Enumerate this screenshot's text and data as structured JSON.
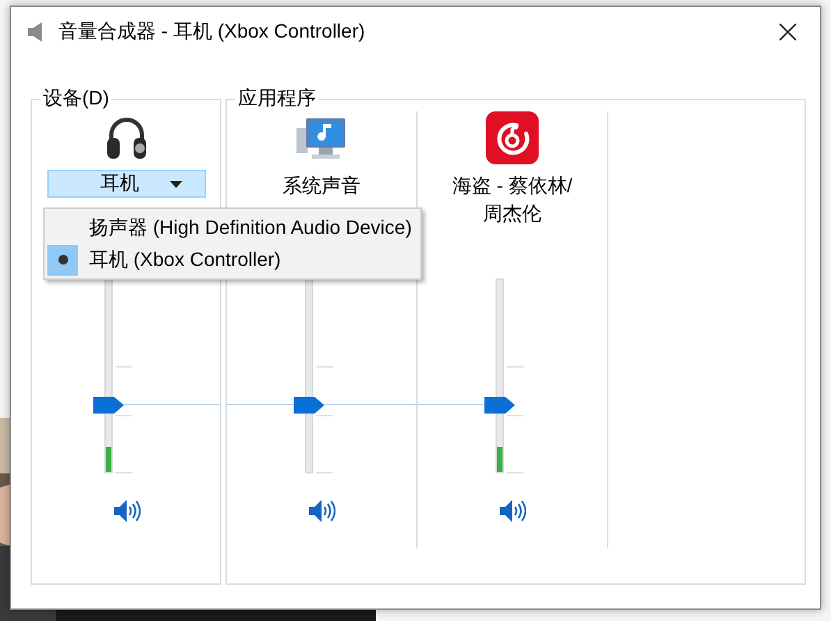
{
  "window": {
    "title": "音量合成器 - 耳机 (Xbox Controller)"
  },
  "device_group": {
    "label": "设备(D)",
    "device": {
      "kind": "headphones",
      "selected_device": "耳机",
      "meter": {
        "level": 0.13
      },
      "volume": {
        "level": 0.35
      },
      "muted": false
    }
  },
  "device_menu": {
    "items": [
      {
        "label": "扬声器 (High Definition Audio Device)",
        "selected": false
      },
      {
        "label": "耳机 (Xbox Controller)",
        "selected": true
      }
    ]
  },
  "applications": {
    "label": "应用程序",
    "channels": [
      {
        "kind": "system",
        "name": "系统声音",
        "meter": {
          "level": 0
        },
        "volume": {
          "level": 0.35
        },
        "muted": false
      },
      {
        "kind": "app",
        "name": "海盗 - 蔡依林/周杰伦",
        "meter": {
          "level": 0.13
        },
        "volume": {
          "level": 0.35
        },
        "muted": false
      }
    ]
  }
}
